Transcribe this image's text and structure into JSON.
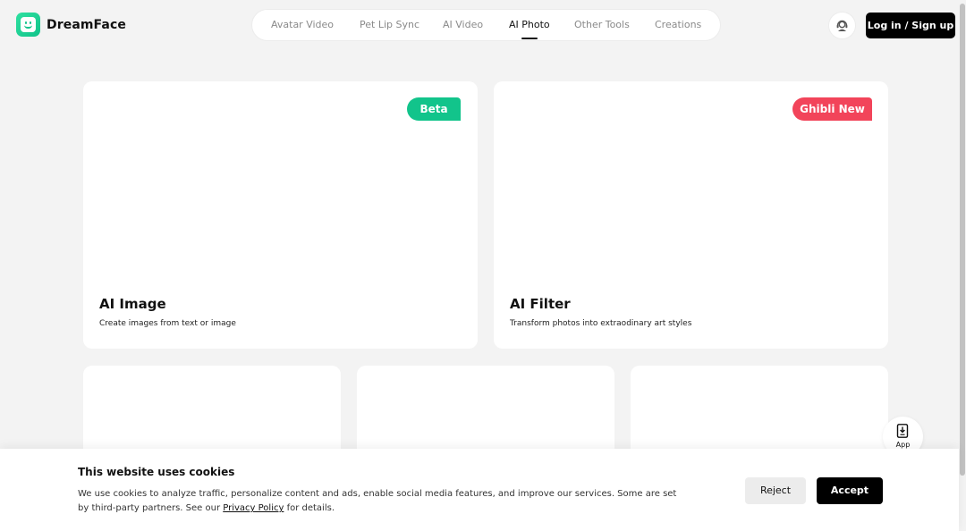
{
  "brand": {
    "name": "DreamFace"
  },
  "nav": {
    "items": [
      {
        "label": "Avatar Video"
      },
      {
        "label": "Pet Lip Sync"
      },
      {
        "label": "AI Video"
      },
      {
        "label": "AI Photo"
      },
      {
        "label": "Other Tools"
      },
      {
        "label": "Creations"
      }
    ],
    "active": "AI Photo"
  },
  "header": {
    "support_icon": "headset-icon",
    "login_label": "Log in / Sign up"
  },
  "cards": [
    {
      "title": "AI Image",
      "desc": "Create images from text or image",
      "badge": "Beta",
      "badge_color": "#12c48b"
    },
    {
      "title": "AI Filter",
      "desc": "Transform photos into extraodinary art styles",
      "badge": "Ghibli New",
      "badge_color": "#f2445a"
    }
  ],
  "app_button": {
    "label": "App",
    "icon": "download-phone-icon"
  },
  "cookie": {
    "title": "This website uses cookies",
    "text_before": "We use cookies to analyze traffic, personalize content and ads, enable social media features, and improve our services. Some are set by third-party partners. See our ",
    "link": "Privacy Policy",
    "text_after": " for details.",
    "reject_label": "Reject",
    "accept_label": "Accept"
  }
}
